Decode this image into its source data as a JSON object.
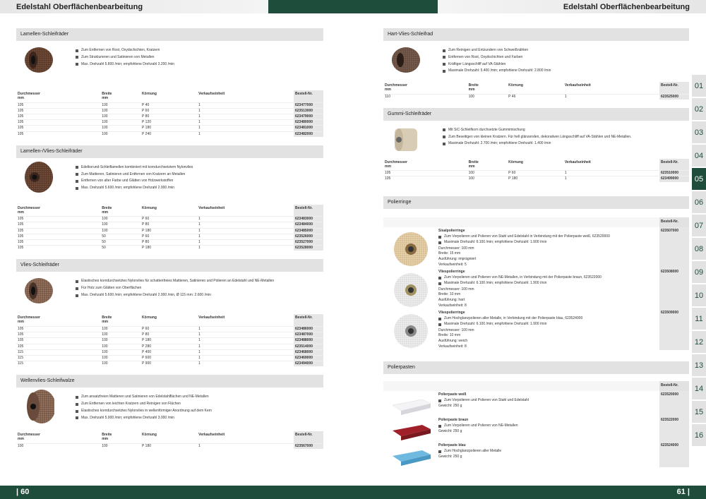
{
  "header": {
    "title_left": "Edelstahl Oberflächenbearbeitung",
    "title_right": "Edelstahl Oberflächenbearbeitung"
  },
  "footer": {
    "page_left": "| 60",
    "page_right": "61 |"
  },
  "table_headers": {
    "d": "Durchmesser",
    "d_unit": "mm",
    "b": "Breite",
    "b_unit": "mm",
    "k": "Körnung",
    "v": "Verkaufseinheit",
    "n": "Bestell-Nr."
  },
  "left": [
    {
      "title": "Lamellen-Schleifräder",
      "bullets": [
        "Zum Entfernen von Rost, Oxydschichten, Kratzern",
        "Zum Strukturieren und Satinieren von Metallen",
        "Max. Drehzahl 5.800 /min; empfohlene Drehzahl 3.200 /min"
      ],
      "rows": [
        [
          "105",
          "100",
          "P 40",
          "1",
          "623477000"
        ],
        [
          "105",
          "100",
          "P 60",
          "1",
          "623513000"
        ],
        [
          "105",
          "100",
          "P 80",
          "1",
          "623479000"
        ],
        [
          "105",
          "100",
          "P 120",
          "1",
          "623480000"
        ],
        [
          "105",
          "100",
          "P 180",
          "1",
          "623481000"
        ],
        [
          "105",
          "100",
          "P 240",
          "1",
          "623482000"
        ]
      ]
    },
    {
      "title": "Lamellen-/Vlies-Schleifräder",
      "bullets": [
        "Edelkorund-Schleiflamellen kombiniert mit korndurchsetztem Nylonvlies",
        "Zum Mattieren, Satinieren und Entfernen von Kratzern an Metallen",
        "Entfernen von alter Farbe und Glätten von Holzwerkstoffen",
        "Max. Drehzahl 5.600 /min; empfohlene Drehzahl 2.900 /min"
      ],
      "rows": [
        [
          "105",
          "100",
          "P 60",
          "1",
          "623483000"
        ],
        [
          "105",
          "100",
          "P 80",
          "1",
          "623484000"
        ],
        [
          "105",
          "100",
          "P 180",
          "1",
          "623485000"
        ],
        [
          "105",
          "50",
          "P 60",
          "1",
          "623526000"
        ],
        [
          "105",
          "50",
          "P 80",
          "1",
          "623527000"
        ],
        [
          "105",
          "50",
          "P 180",
          "1",
          "623528000"
        ]
      ]
    },
    {
      "title": "Vlies-Schleifräder",
      "bullets": [
        "Elastisches korndurchsetztes Nylonvlies für schattenfreies Mattieren, Satinieren und Polieren an Edelstahl und NE-Metallen",
        "Für Holz zum Glätten von Oberflächen",
        "Max. Drehzahl 5.600 /min; empfohlene Drehzahl 2.900 /min, Ø 115 mm: 2.600 /min"
      ],
      "rows": [
        [
          "105",
          "100",
          "P 60",
          "1",
          "623486000"
        ],
        [
          "105",
          "100",
          "P 80",
          "1",
          "623487000"
        ],
        [
          "105",
          "100",
          "P 180",
          "1",
          "623488000"
        ],
        [
          "105",
          "100",
          "P 280",
          "1",
          "623514000"
        ],
        [
          "115",
          "100",
          "P 400",
          "1",
          "623468000"
        ],
        [
          "115",
          "100",
          "P 600",
          "1",
          "623469000"
        ],
        [
          "115",
          "100",
          "P 900",
          "1",
          "623494000"
        ]
      ]
    },
    {
      "title": "Wellenvlies-Schleifwalze",
      "bullets": [
        "Zum ansatzfreien Mattieren und Satinieren von Edelstahlflächen und NE-Metallen",
        "Zum Entfernen von leichten Kratzern und Reinigen von Flächen",
        "Elastisches korndurchsetztes Nylonvlies in wellenförmiger Anordnung auf dem Kern",
        "Max. Drehzahl 5.900 /min; empfohlene Drehzahl 3.000 /min"
      ],
      "rows": [
        [
          "100",
          "100",
          "P 180",
          "1",
          "623567000"
        ]
      ]
    }
  ],
  "right": [
    {
      "title": "Hart-Vlies-Schleifrad",
      "bullets": [
        "Zum Reinigen und Entzundern von Schweißnähten",
        "Entfernen von Rost, Oxydschichten und Farben",
        "Kräftiger Längsschliff auf VA-Stählen",
        "Maximale Drehzahl: 5.400 /min; empfohlene Drehzahl: 2.800 /min"
      ],
      "rows": [
        [
          "110",
          "100",
          "P 46",
          "1",
          "623525000"
        ]
      ]
    },
    {
      "title": "Gummi-Schleifräder",
      "bullets": [
        "Mit SiC-Schleifkorn durchsetzte Gummimischung",
        "Zum Beseitigen von kleinen Kratzern. Für hell glänzenden, dekorativen Längsschliff auf VA-Stählen und NE-Metallen.",
        "Maximale Drehzahl: 2.700 /min; empfohlene Drehzahl: 1.400 /min"
      ],
      "rows": [
        [
          "105",
          "100",
          "P 60",
          "1",
          "623510000"
        ],
        [
          "105",
          "100",
          "P 180",
          "1",
          "623499000"
        ]
      ]
    }
  ],
  "polierringe": {
    "title": "Polierringe",
    "nr_label": "Bestell-Nr.",
    "items": [
      {
        "name": "Sisalpolierringe",
        "b1": "Zum Vorpolieren und Polieren von Stahl und Edelstahl in Verbindung mit der Polierpaste weiß, 623520000",
        "b2": "Maximale Drehzahl: 6.100 /min; empfohlene Drehzahl: 1.900 /min",
        "l1": "Durchmesser: 100 mm",
        "l2": "Breite: 15 mm",
        "l3": "Ausführung: imprägniert",
        "l4": "Verkaufseinheit: 5",
        "nr": "623507000"
      },
      {
        "name": "Vliespolierringe",
        "b1": "Zum Vorpolieren und Polieren von NE-Metallen, in Verbindung mit der Polierpaste braun, 623522000",
        "b2": "Maximale Drehzahl: 6.100 /min; empfohlene Drehzahl: 1.900 /min",
        "l1": "Durchmesser: 100 mm",
        "l2": "Breite: 10 mm",
        "l3": "Ausführung: hart",
        "l4": "Verkaufseinheit: 8",
        "nr": "623508000"
      },
      {
        "name": "Vliespolierringe",
        "b1": "Zum Hochglanzpolieren aller Metalle, in Verbindung mit der Polierpaste blau, 623524000",
        "b2": "Maximale Drehzahl: 6.100 /min; empfohlene Drehzahl: 1.900 /min",
        "l1": "Durchmesser: 100 mm",
        "l2": "Breite: 10 mm",
        "l3": "Ausführung: weich",
        "l4": "Verkaufseinheit: 8",
        "nr": "623509000"
      }
    ]
  },
  "polierpasten": {
    "title": "Polierpasten",
    "nr_label": "Bestell-Nr.",
    "items": [
      {
        "name": "Polierpaste weiß",
        "b1": "Zum Vorpolieren und Polieren von Stahl und Edelstahl",
        "w": "Gewicht: 250 g",
        "nr": "623520000",
        "color": "#f4f4f6"
      },
      {
        "name": "Polierpaste braun",
        "b1": "Zum Vorpolieren und Polieren von NE-Metallen",
        "w": "Gewicht: 250 g",
        "nr": "623522000",
        "color": "#a0202a"
      },
      {
        "name": "Polierpaste blau",
        "b1": "Zum Hochglanzpolieren aller Metalle",
        "w": "Gewicht: 250 g",
        "nr": "623524000",
        "color": "#6fb9e0"
      }
    ]
  },
  "sidebar_tabs": [
    "01",
    "02",
    "03",
    "04",
    "05",
    "06",
    "07",
    "08",
    "09",
    "10",
    "11",
    "12",
    "13",
    "14",
    "15",
    "16"
  ],
  "sidebar_active": "05",
  "colors": {
    "brand_green": "#1e4d3b",
    "section_grey": "#e2e2e2"
  }
}
